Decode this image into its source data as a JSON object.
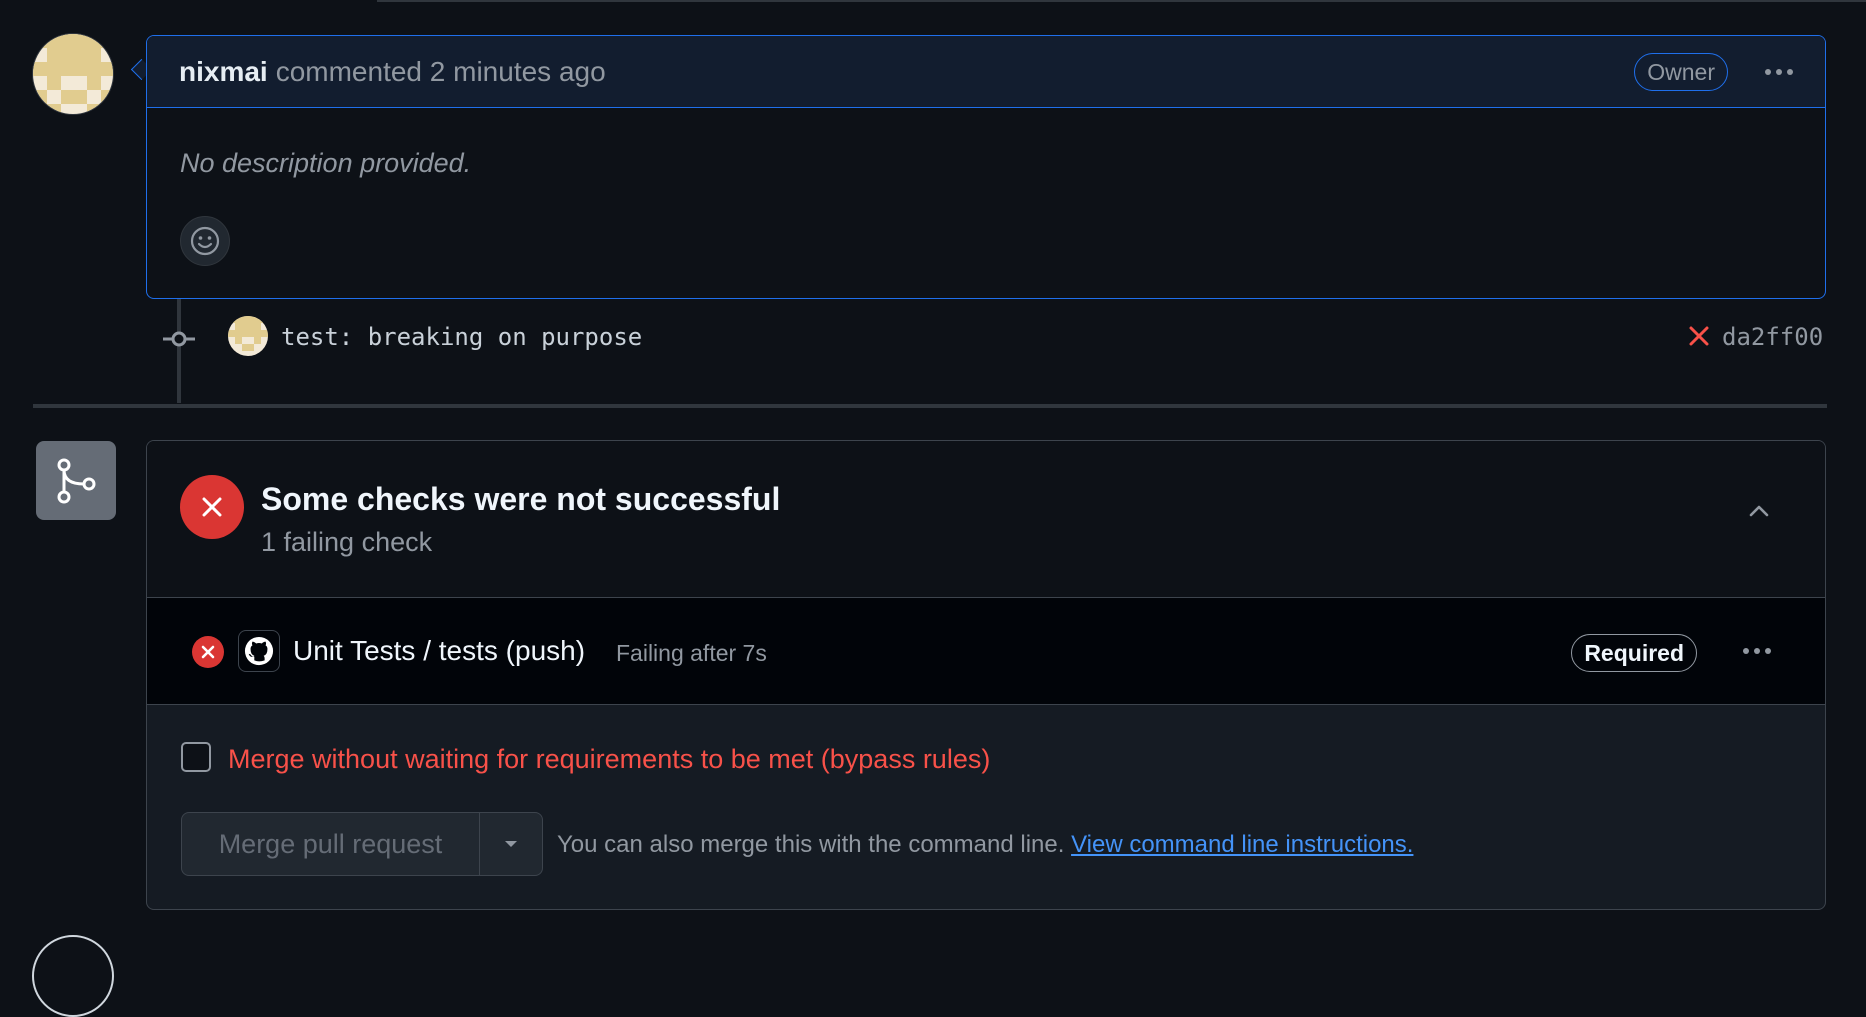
{
  "comment": {
    "author": "nixmai",
    "action": "commented",
    "time": "2 minutes ago",
    "badge": "Owner",
    "body": "No description provided."
  },
  "commit": {
    "message": "test: breaking on purpose",
    "sha": "da2ff00",
    "status": "failed"
  },
  "mergebox": {
    "title": "Some checks were not successful",
    "subtitle": "1 failing check",
    "checks": [
      {
        "name": "Unit Tests / tests (push)",
        "status": "Failing after 7s",
        "badge": "Required"
      }
    ],
    "bypass_label": "Merge without waiting for requirements to be met (bypass rules)",
    "merge_button": "Merge pull request",
    "cli_text": "You can also merge this with the command line.",
    "cli_link": "View command line instructions."
  },
  "colors": {
    "accent_blue": "#1f6feb",
    "danger": "#da3633",
    "danger_text": "#f85149",
    "link": "#4493f8"
  }
}
